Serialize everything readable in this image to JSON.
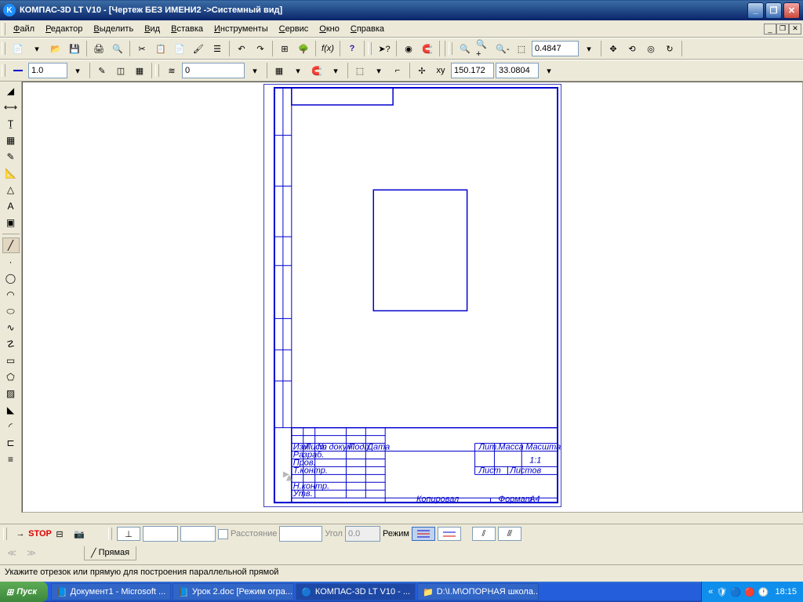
{
  "title": "КОМПАС-3D LT V10 - [Чертеж БЕЗ ИМЕНИ2 ->Системный вид]",
  "menu": [
    "Файл",
    "Редактор",
    "Выделить",
    "Вид",
    "Вставка",
    "Инструменты",
    "Сервис",
    "Окно",
    "Справка"
  ],
  "toolbar2": {
    "zoom": "0.4847"
  },
  "toolbar3": {
    "style": "1.0",
    "layer": "0",
    "x": "150.172",
    "y": "33.0804"
  },
  "bottom": {
    "distance_label": "Расстояние",
    "distance_val": "",
    "angle_label": "Угол",
    "angle_val": "0.0",
    "mode_label": "Режим",
    "tab": "Прямая"
  },
  "status": "Укажите отрезок или прямую для построения параллельной прямой",
  "taskbar": {
    "start": "Пуск",
    "items": [
      "Документ1 - Microsoft ...",
      "Урок 2.doc [Режим огра...",
      "КОМПАС-3D LT V10 - ...",
      "D:\\I.M\\ОПОРНАЯ школа..."
    ],
    "time": "18:15"
  },
  "titleblock": {
    "kopiroval": "Копировал",
    "format": "Формат",
    "a4": "A4",
    "list": "Лист",
    "listov": "Листов",
    "lit": "Лит.",
    "massa": "Масса",
    "masshtab": "Масштаб",
    "scale": "1:1",
    "izm": "Изм",
    "listn": "Лист",
    "ndokum": "№ докум.",
    "podp": "Подп.",
    "data": "Дата",
    "razrab": "Разраб.",
    "prov": "Пров.",
    "tkontr": "Т.контр.",
    "nkontr": "Н.контр.",
    "utv": "Утв."
  }
}
